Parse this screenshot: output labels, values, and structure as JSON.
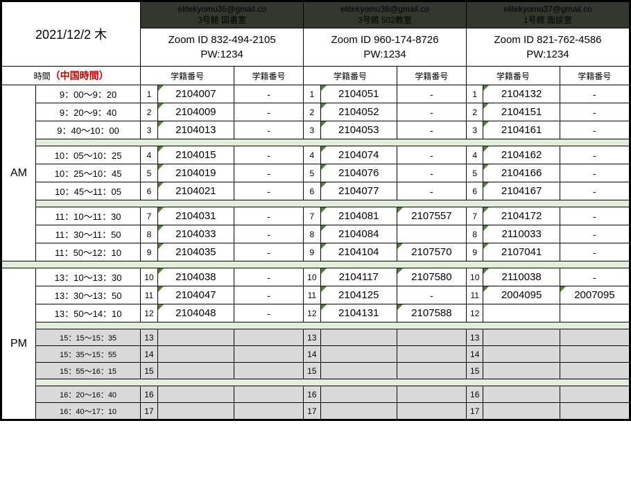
{
  "date": "2021/12/2  木",
  "time_header": "時間",
  "china_time": "（中国時間）",
  "col_label": "学籍番号",
  "am_label": "AM",
  "pm_label": "PM",
  "rooms": [
    {
      "email": "elitekyomu35@gmail.co",
      "name": "3号館  図書室",
      "zoom": "Zoom ID 832-494-2105",
      "pw": "PW:1234"
    },
    {
      "email": "elitekyomu36@gmail.co",
      "name": "3号館  502教室",
      "zoom": "Zoom ID 960-174-8726",
      "pw": "PW:1234"
    },
    {
      "email": "elitekyomu37@gmail.co",
      "name": "1号館  面談室",
      "zoom": "Zoom ID 821-762-4586",
      "pw": "PW:1234"
    }
  ],
  "blocks": [
    {
      "period": "AM",
      "groups": [
        {
          "rows": [
            {
              "n": "1",
              "time": "9：00～9：20",
              "r1a": "2104007",
              "r1b": "-",
              "r2a": "2104051",
              "r2b": "-",
              "r3a": "2104132",
              "r3b": "-"
            },
            {
              "n": "2",
              "time": "9：20～9：40",
              "r1a": "2104009",
              "r1b": "-",
              "r2a": "2104052",
              "r2b": "-",
              "r3a": "2104151",
              "r3b": "-"
            },
            {
              "n": "3",
              "time": "9：40～10：00",
              "r1a": "2104013",
              "r1b": "-",
              "r2a": "2104053",
              "r2b": "-",
              "r3a": "2104161",
              "r3b": "-"
            }
          ]
        },
        {
          "rows": [
            {
              "n": "4",
              "time": "10：05～10：25",
              "r1a": "2104015",
              "r1b": "-",
              "r2a": "2104074",
              "r2b": "-",
              "r3a": "2104162",
              "r3b": "-"
            },
            {
              "n": "5",
              "time": "10：25～10：45",
              "r1a": "2104019",
              "r1b": "-",
              "r2a": "2104076",
              "r2b": "-",
              "r3a": "2104166",
              "r3b": "-"
            },
            {
              "n": "6",
              "time": "10：45～11：05",
              "r1a": "2104021",
              "r1b": "-",
              "r2a": "2104077",
              "r2b": "-",
              "r3a": "2104167",
              "r3b": "-"
            }
          ]
        },
        {
          "rows": [
            {
              "n": "7",
              "time": "11：10～11：30",
              "r1a": "2104031",
              "r1b": "-",
              "r2a": "2104081",
              "r2b": "2107557",
              "r3a": "2104172",
              "r3b": "-"
            },
            {
              "n": "8",
              "time": "11：30～11：50",
              "r1a": "2104033",
              "r1b": "-",
              "r2a": "2104084",
              "r2b": "",
              "r3a": "2110033",
              "r3b": "-"
            },
            {
              "n": "9",
              "time": "11：50～12：10",
              "r1a": "2104035",
              "r1b": "-",
              "r2a": "2104104",
              "r2b": "2107570",
              "r3a": "2107041",
              "r3b": "-"
            }
          ]
        }
      ]
    },
    {
      "period": "PM",
      "groups": [
        {
          "rows": [
            {
              "n": "10",
              "time": "13：10～13：30",
              "r1a": "2104038",
              "r1b": "-",
              "r2a": "2104117",
              "r2b": "2107580",
              "r3a": "2110038",
              "r3b": "-"
            },
            {
              "n": "11",
              "time": "13：30～13：50",
              "r1a": "2104047",
              "r1b": "-",
              "r2a": "2104125",
              "r2b": "-",
              "r3a": "2004095",
              "r3b": "2007095"
            },
            {
              "n": "12",
              "time": "13：50～14：10",
              "r1a": "2104048",
              "r1b": "-",
              "r2a": "2104131",
              "r2b": "2107588",
              "r3a": "",
              "r3b": ""
            }
          ]
        },
        {
          "grey": true,
          "rows": [
            {
              "n": "13",
              "time": "15：15～15：35",
              "r1a": "",
              "r1b": "",
              "r2a": "",
              "r2b": "",
              "r3a": "",
              "r3b": ""
            },
            {
              "n": "14",
              "time": "15：35～15：55",
              "r1a": "",
              "r1b": "",
              "r2a": "",
              "r2b": "",
              "r3a": "",
              "r3b": ""
            },
            {
              "n": "15",
              "time": "15：55～16：15",
              "r1a": "",
              "r1b": "",
              "r2a": "",
              "r2b": "",
              "r3a": "",
              "r3b": ""
            }
          ]
        },
        {
          "grey": true,
          "rows": [
            {
              "n": "16",
              "time": "16：20～16：40",
              "r1a": "",
              "r1b": "",
              "r2a": "",
              "r2b": "",
              "r3a": "",
              "r3b": ""
            },
            {
              "n": "17",
              "time": "16：40～17：10",
              "r1a": "",
              "r1b": "",
              "r2a": "",
              "r2b": "",
              "r3a": "",
              "r3b": ""
            }
          ]
        }
      ]
    }
  ]
}
